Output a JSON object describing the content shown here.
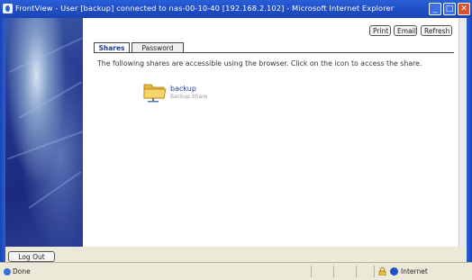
{
  "window": {
    "title": "FrontView - User [backup] connected to nas-00-10-40 [192.168.2.102] - Microsoft Internet Explorer",
    "min_glyph": "_",
    "max_glyph": "□",
    "close_glyph": "✕"
  },
  "toolbar": {
    "print_label": "Print",
    "email_label": "Email",
    "refresh_label": "Refresh"
  },
  "tabs": [
    {
      "label": "Shares",
      "selected": true
    },
    {
      "label": "Password",
      "selected": false
    }
  ],
  "main": {
    "intro": "The following shares are accessible using the browser. Click on the icon to access the share.",
    "share": {
      "name": "backup",
      "description": "Backup Share",
      "icon": "folder-network-icon"
    }
  },
  "sidebar": {
    "logout_label": "Log Out"
  },
  "status": {
    "text": "Done",
    "zone": "Internet",
    "icons": [
      "ie-page-icon",
      "lock-icon",
      "internet-zone-icon"
    ]
  },
  "colors": {
    "titlebar": "#1f4fc6",
    "link": "#1e3f9a",
    "close": "#d8512b"
  }
}
